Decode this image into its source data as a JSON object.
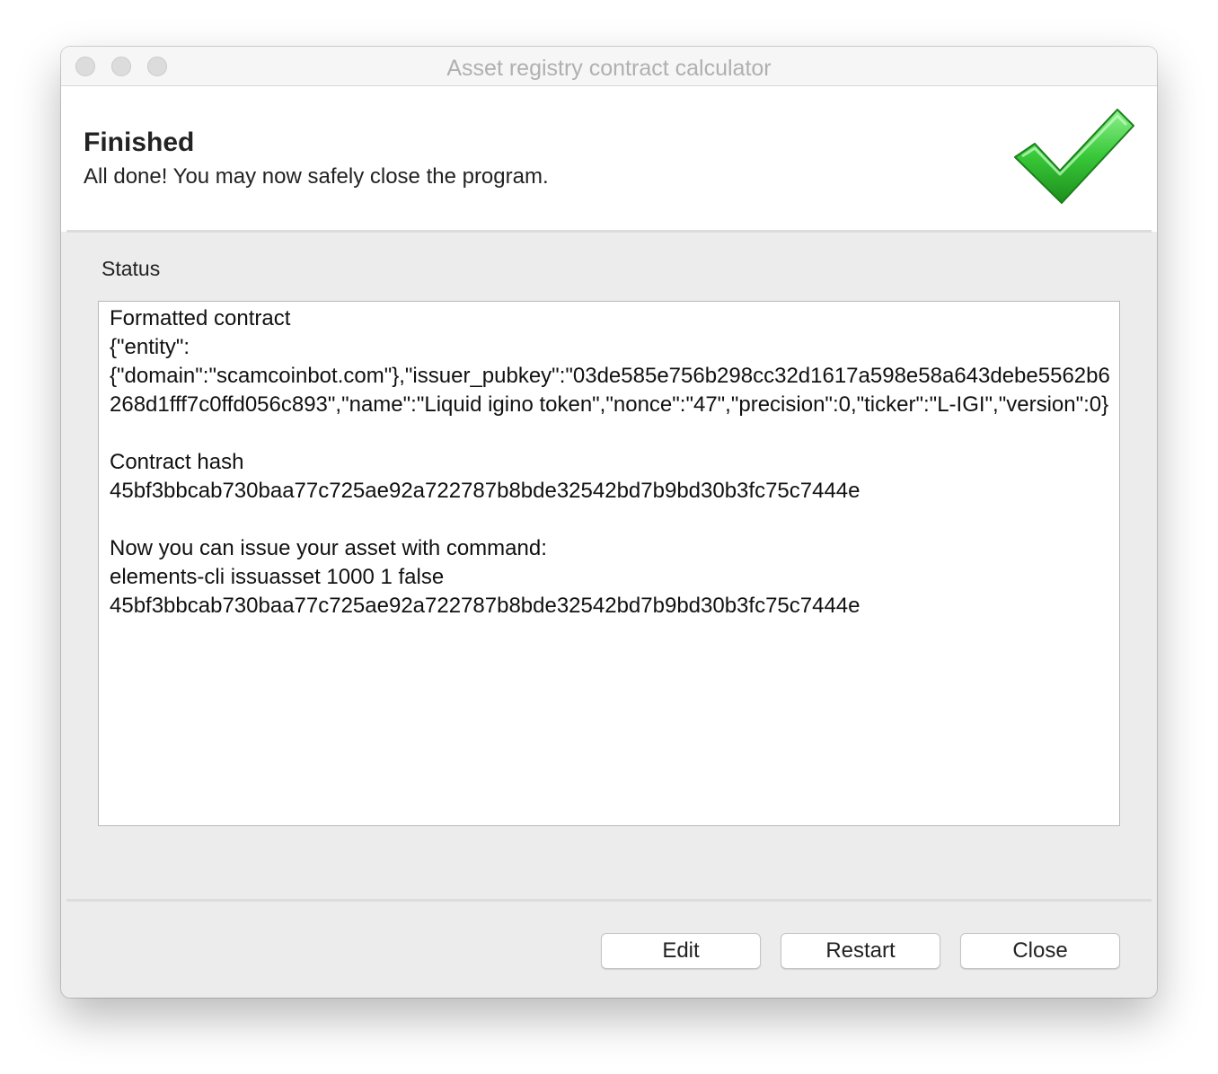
{
  "window": {
    "title": "Asset registry contract calculator"
  },
  "header": {
    "title": "Finished",
    "subtitle": "All done! You may now safely close the program.",
    "icon": "green-checkmark-icon"
  },
  "status": {
    "label": "Status",
    "text": "Formatted contract\n{\"entity\":\n{\"domain\":\"scamcoinbot.com\"},\"issuer_pubkey\":\"03de585e756b298cc32d1617a598e58a643debe5562b6268d1fff7c0ffd056c893\",\"name\":\"Liquid igino token\",\"nonce\":\"47\",\"precision\":0,\"ticker\":\"L-IGI\",\"version\":0}\n\nContract hash\n45bf3bbcab730baa77c725ae92a722787b8bde32542bd7b9bd30b3fc75c7444e\n\nNow you can issue your asset with command:\nelements-cli issuasset 1000 1 false\n45bf3bbcab730baa77c725ae92a722787b8bde32542bd7b9bd30b3fc75c7444e"
  },
  "buttons": {
    "edit": "Edit",
    "restart": "Restart",
    "close": "Close"
  },
  "colors": {
    "check_green": "#3fbf3f",
    "window_bg": "#ececec"
  }
}
